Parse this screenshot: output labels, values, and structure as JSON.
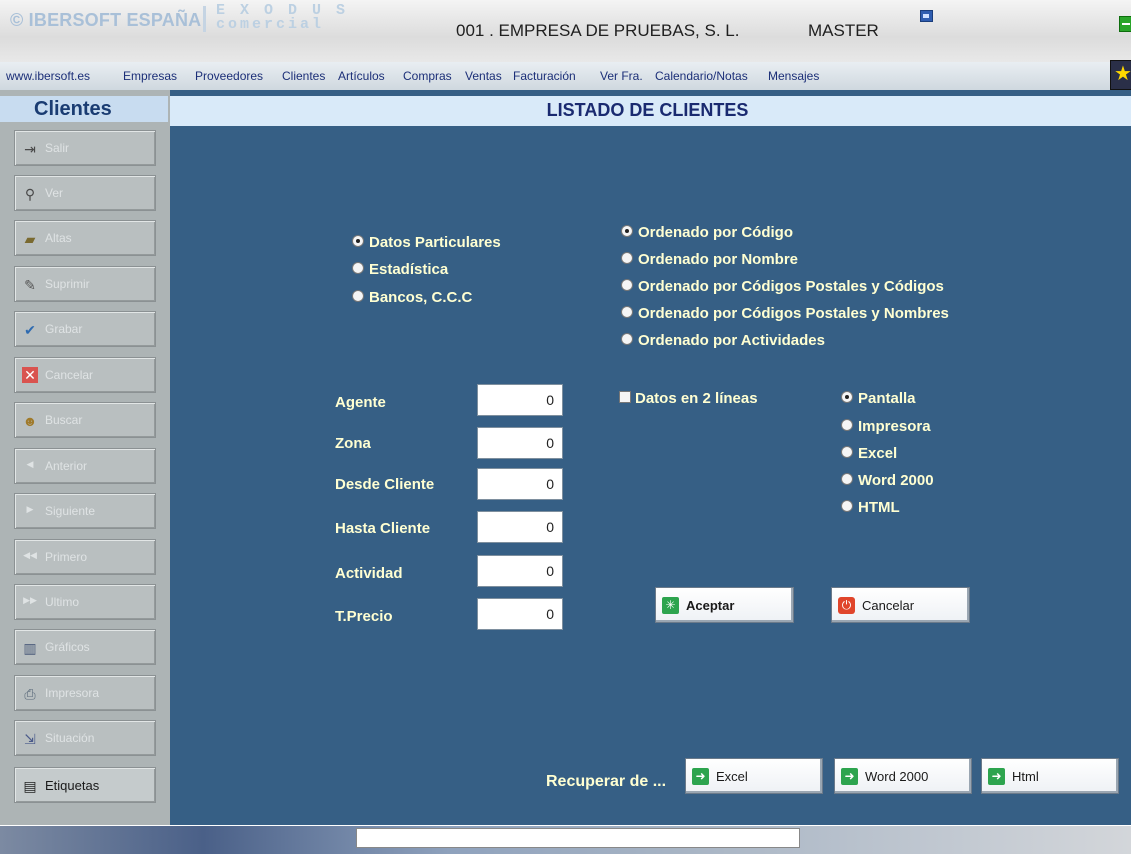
{
  "header": {
    "brand": "© IBERSOFT ESPAÑA",
    "product_line1": "E X O D U S",
    "product_line2": "comercial",
    "company": "001 . EMPRESA DE PRUEBAS, S. L.",
    "user": "MASTER"
  },
  "menu": {
    "items": [
      "www.ibersoft.es",
      "Empresas",
      "Proveedores",
      "Clientes",
      "Artículos",
      "Compras",
      "Ventas",
      "Facturación",
      "Ver Fra.",
      "Calendario/Notas",
      "Mensajes"
    ]
  },
  "sidebar": {
    "title": "Clientes",
    "buttons": [
      {
        "label": "Salir",
        "icon": "exit-icon"
      },
      {
        "label": "Ver",
        "icon": "magnifier-icon"
      },
      {
        "label": "Altas",
        "icon": "folder-open-icon"
      },
      {
        "label": "Suprimir",
        "icon": "pencil-erase-icon"
      },
      {
        "label": "Grabar",
        "icon": "checkmark-icon"
      },
      {
        "label": "Cancelar",
        "icon": "cancel-x-icon"
      },
      {
        "label": "Buscar",
        "icon": "people-search-icon"
      },
      {
        "label": "Anterior",
        "icon": "arrow-left-icon"
      },
      {
        "label": "Siguiente",
        "icon": "arrow-right-icon"
      },
      {
        "label": "Primero",
        "icon": "double-arrow-left-icon"
      },
      {
        "label": "Ultimo",
        "icon": "double-arrow-right-icon"
      },
      {
        "label": "Gráficos",
        "icon": "bar-chart-icon"
      },
      {
        "label": "Impresora",
        "icon": "printer-icon"
      },
      {
        "label": "Situación",
        "icon": "situation-icon"
      },
      {
        "label": "Etiquetas",
        "icon": "labels-icon"
      }
    ]
  },
  "main": {
    "title": "LISTADO DE CLIENTES",
    "data_type_options": [
      {
        "label": "Datos Particulares",
        "checked": true
      },
      {
        "label": "Estadística",
        "checked": false
      },
      {
        "label": "Bancos, C.C.C",
        "checked": false
      }
    ],
    "order_options": [
      {
        "label": "Ordenado por Código",
        "checked": true
      },
      {
        "label": "Ordenado por Nombre",
        "checked": false
      },
      {
        "label": "Ordenado por Códigos Postales y Códigos",
        "checked": false
      },
      {
        "label": "Ordenado por Códigos Postales y Nombres",
        "checked": false
      },
      {
        "label": "Ordenado por Actividades",
        "checked": false
      }
    ],
    "fields": [
      {
        "label": "Agente",
        "value": "0"
      },
      {
        "label": "Zona",
        "value": "0"
      },
      {
        "label": "Desde Cliente",
        "value": "0"
      },
      {
        "label": "Hasta Cliente",
        "value": "0"
      },
      {
        "label": "Actividad",
        "value": "0"
      },
      {
        "label": "T.Precio",
        "value": "0"
      }
    ],
    "two_lines_checkbox": {
      "label": "Datos en 2 líneas",
      "checked": false
    },
    "output_options": [
      {
        "label": "Pantalla",
        "checked": true
      },
      {
        "label": "Impresora",
        "checked": false
      },
      {
        "label": "Excel",
        "checked": false
      },
      {
        "label": "Word 2000",
        "checked": false
      },
      {
        "label": "HTML",
        "checked": false
      }
    ],
    "accept_label": "Aceptar",
    "cancel_label": "Cancelar",
    "recover_label": "Recuperar de ...",
    "recover_buttons": [
      "Excel",
      "Word 2000",
      "Html"
    ]
  },
  "colors": {
    "main_bg": "#365f85",
    "label_text": "#ffffd2",
    "title_text": "#1a2a70"
  }
}
